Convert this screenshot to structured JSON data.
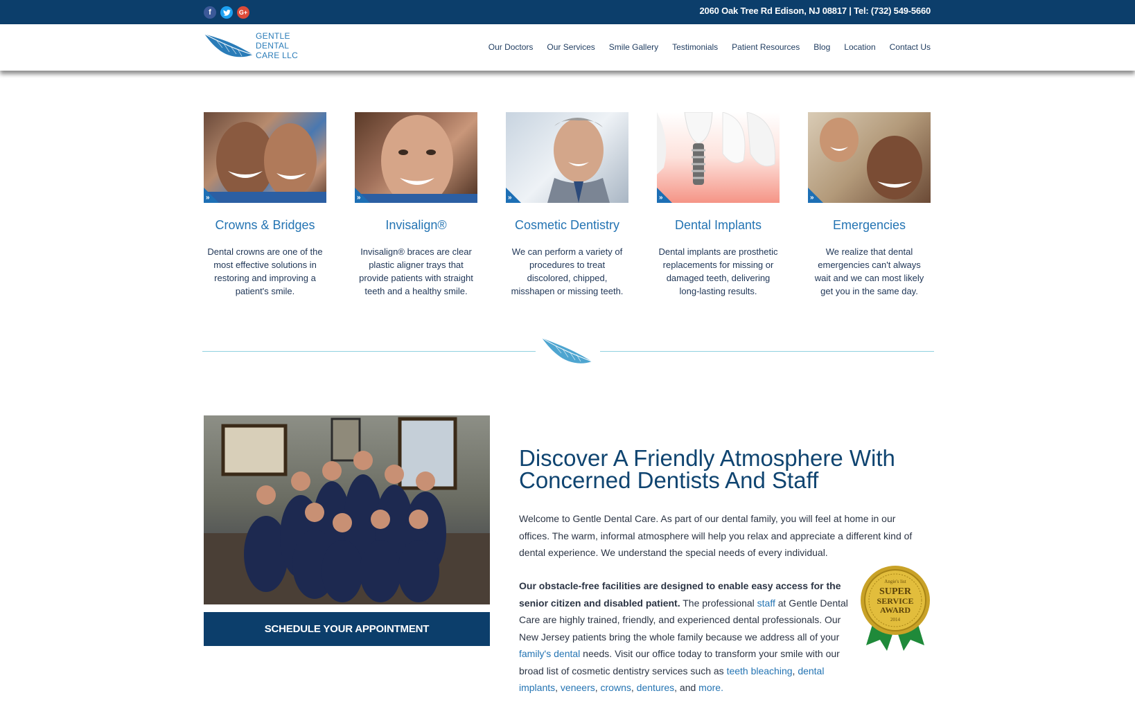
{
  "topbar": {
    "social": [
      {
        "icon": "facebook-icon",
        "glyph": "f",
        "color": "#3b5998"
      },
      {
        "icon": "twitter-icon",
        "glyph": "t",
        "color": "#1da1f2"
      },
      {
        "icon": "google-plus-icon",
        "glyph": "G+",
        "color": "#dd4b39"
      }
    ],
    "contact": "2060 Oak Tree Rd Edison, NJ 08817 | Tel: (732) 549-5660"
  },
  "logo": {
    "line1": "GENTLE",
    "line2": "DENTAL",
    "line3": "CARE LLC"
  },
  "nav": [
    {
      "label": "Our Doctors"
    },
    {
      "label": "Our Services"
    },
    {
      "label": "Smile Gallery"
    },
    {
      "label": "Testimonials"
    },
    {
      "label": "Patient Resources"
    },
    {
      "label": "Blog"
    },
    {
      "label": "Location"
    },
    {
      "label": "Contact Us"
    }
  ],
  "services": [
    {
      "title": "Crowns & Bridges",
      "text": "Dental crowns are one of the most effective solutions in restoring and improving a patient's smile."
    },
    {
      "title": "Invisalign®",
      "text": "Invisalign® braces are clear plastic aligner trays that provide patients with straight teeth and a healthy smile."
    },
    {
      "title": "Cosmetic Dentistry",
      "text": "We can perform a variety of procedures to treat discolored, chipped, misshapen or missing teeth."
    },
    {
      "title": "Dental Implants",
      "text": "Dental implants are prosthetic replacements for missing or damaged teeth, delivering long-lasting results."
    },
    {
      "title": "Emergencies",
      "text": "We realize that dental emergencies can't always wait and we can most likely get you in the same day."
    }
  ],
  "about": {
    "cta": "SCHEDULE YOUR APPOINTMENT",
    "title_line1": "Discover A Friendly Atmosphere With",
    "title_line2": "Concerned Dentists And Staff",
    "p1": "Welcome to Gentle Dental Care. As part of our dental family, you will feel at home in our offices. The warm, informal atmosphere will help you relax and appreciate a different kind of dental experience. We understand the special needs of every individual.",
    "p2_bold": "Our obstacle-free facilities are designed to enable easy access for the senior citizen and disabled patient.",
    "p2_a": " The professional ",
    "p2_link_staff": "staff",
    "p2_b": " at Gentle Dental Care are highly trained, friendly, and experienced dental professionals. Our New Jersey patients bring the whole family because we address all of your ",
    "p2_link_family": "family's dental",
    "p2_c": " needs. Visit our office today to transform your smile with our broad list of cosmetic dentistry services such as ",
    "p2_link_bleaching": "teeth bleaching",
    "p2_sep1": ", ",
    "p2_link_implants": "dental implants",
    "p2_sep2": ", ",
    "p2_link_veneers": "veneers",
    "p2_sep3": ", ",
    "p2_link_crowns": "crowns",
    "p2_sep4": ", ",
    "p2_link_dentures": "dentures",
    "p2_d": ", and ",
    "p2_link_more": "more."
  },
  "award": {
    "top": "Angie's list",
    "line1": "SUPER",
    "line2": "SERVICE",
    "line3": "AWARD",
    "year": "2014"
  },
  "colors": {
    "navy": "#0c3e6b",
    "accent": "#2474b3",
    "light_blue": "#8fd0e0"
  }
}
